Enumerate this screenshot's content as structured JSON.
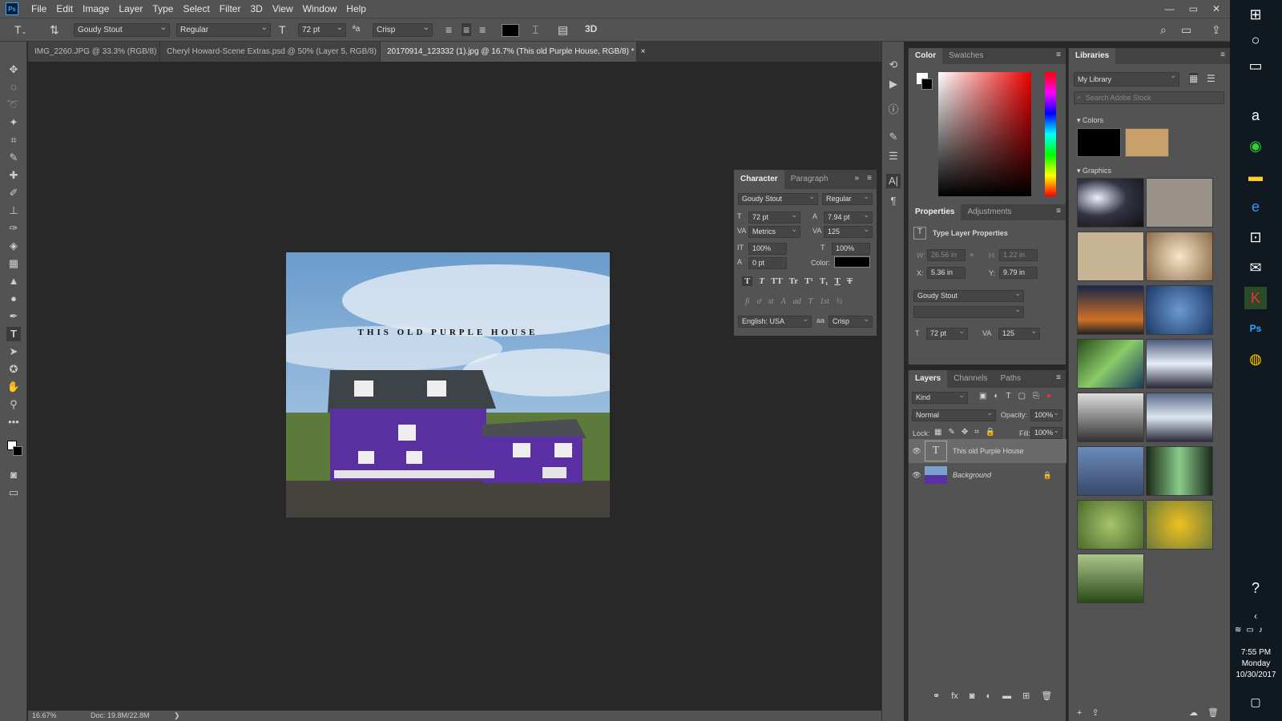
{
  "menubar": {
    "app_icon": "Ps",
    "items": [
      "File",
      "Edit",
      "Image",
      "Layer",
      "Type",
      "Select",
      "Filter",
      "3D",
      "View",
      "Window",
      "Help"
    ],
    "window_controls": [
      "—",
      "▭",
      "✕"
    ]
  },
  "options": {
    "font_family": "Goudy Stout",
    "font_style": "Regular",
    "font_size": "72 pt",
    "antialias": "Crisp",
    "text_color": "#000000",
    "three_d": "3D"
  },
  "tabs": [
    {
      "label": "IMG_2260.JPG @ 33.3% (RGB/8)",
      "close": "×"
    },
    {
      "label": "Cheryl Howard-Scene Extras.psd @ 50% (Layer 5, RGB/8)",
      "close": "×"
    },
    {
      "label": "20170914_123332 (1).jpg @ 16.7% (This old Purple House, RGB/8) *",
      "close": "×"
    }
  ],
  "document": {
    "overlay_text": "THIS OLD PURPLE HOUSE"
  },
  "status": {
    "zoom": "16.67%",
    "doc": "Doc: 19.8M/22.8M",
    "arrow": "❯"
  },
  "character_panel": {
    "tabs": [
      "Character",
      "Paragraph"
    ],
    "font_family": "Goudy Stout",
    "font_style": "Regular",
    "size": "72 pt",
    "leading": "7.94 pt",
    "kerning": "Metrics",
    "tracking": "125",
    "vscale": "100%",
    "hscale": "100%",
    "baseline": "0 pt",
    "color_label": "Color:",
    "color": "#000000",
    "style_buttons": [
      "T",
      "T",
      "TT",
      "Tr",
      "T¹",
      "T₁",
      "T",
      "T"
    ],
    "ot_buttons": [
      "fi",
      "ơ",
      "st",
      "A",
      "ad",
      "T",
      "1st",
      "½"
    ],
    "language": "English: USA",
    "aa_icon": "aa",
    "antialias": "Crisp"
  },
  "color_panel": {
    "tabs": [
      "Color",
      "Swatches"
    ]
  },
  "properties_panel": {
    "tabs": [
      "Properties",
      "Adjustments"
    ],
    "title": "Type Layer Properties",
    "w_label": "W:",
    "w": "26.56 in",
    "h_label": "H:",
    "h": "1.22 in",
    "x_label": "X:",
    "x": "5.36 in",
    "y_label": "Y:",
    "y": "9.79 in",
    "font_family": "Goudy Stout",
    "size": "72 pt",
    "tracking": "125"
  },
  "layers_panel": {
    "tabs": [
      "Layers",
      "Channels",
      "Paths"
    ],
    "kind": "Kind",
    "blend_mode": "Normal",
    "opacity_label": "Opacity:",
    "opacity": "100%",
    "lock_label": "Lock:",
    "fill_label": "Fill:",
    "fill": "100%",
    "layers": [
      {
        "name": "This old Purple House",
        "thumb": "T"
      },
      {
        "name": "Background",
        "thumb": ""
      }
    ]
  },
  "libraries": {
    "title": "Libraries",
    "library_name": "My Library",
    "search_placeholder": "Search Adobe Stock",
    "colors_header": "Colors",
    "swatches": [
      "#000000",
      "#c9a06a"
    ],
    "graphics_header": "Graphics"
  },
  "taskbar": {
    "time": "7:55 PM",
    "day": "Monday",
    "date": "10/30/2017"
  }
}
